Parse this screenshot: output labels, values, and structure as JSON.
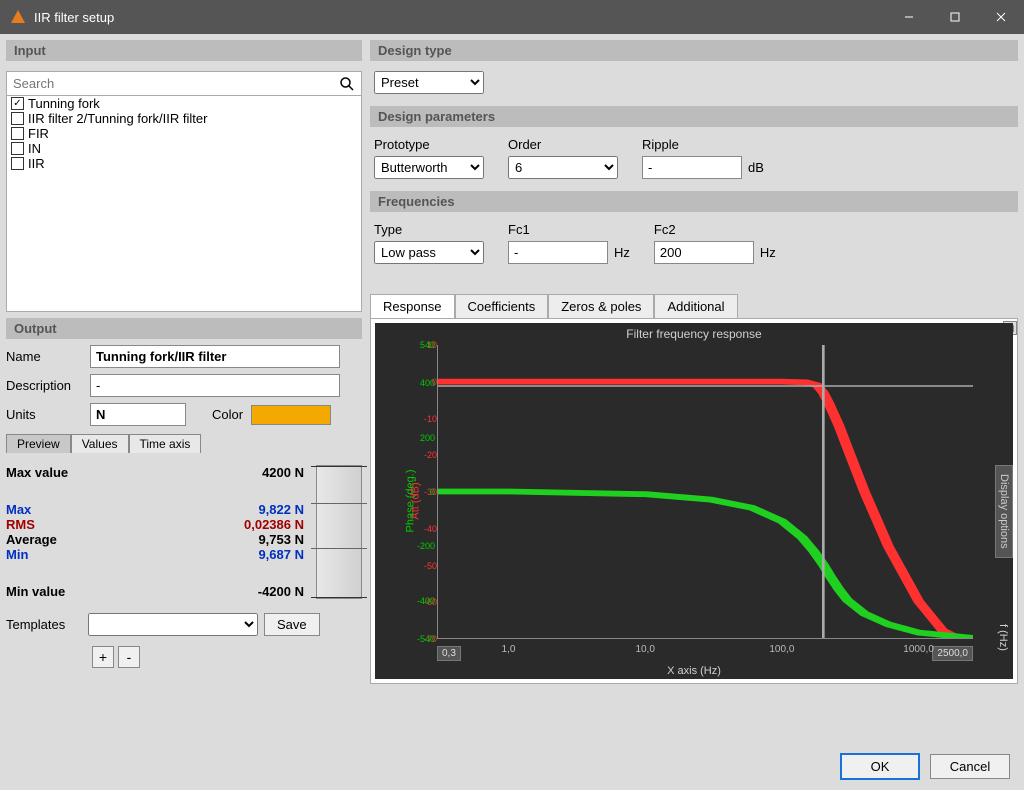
{
  "window": {
    "title": "IIR filter setup"
  },
  "input": {
    "header": "Input",
    "search_placeholder": "Search",
    "items": [
      {
        "label": "Tunning fork",
        "checked": true
      },
      {
        "label": "IIR filter 2/Tunning fork/IIR filter",
        "checked": false
      },
      {
        "label": "FIR",
        "checked": false
      },
      {
        "label": "IN",
        "checked": false
      },
      {
        "label": "IIR",
        "checked": false
      }
    ]
  },
  "output": {
    "header": "Output",
    "name_label": "Name",
    "name_value": "Tunning fork/IIR filter",
    "desc_label": "Description",
    "desc_value": "-",
    "units_label": "Units",
    "units_value": "N",
    "color_label": "Color",
    "color_value": "#f4a900",
    "tabs": {
      "preview": "Preview",
      "values": "Values",
      "time": "Time axis"
    },
    "stats": {
      "maxvalue_label": "Max value",
      "maxvalue": "4200 N",
      "max_label": "Max",
      "max": "9,822 N",
      "rms_label": "RMS",
      "rms": "0,02386 N",
      "avg_label": "Average",
      "avg": "9,753 N",
      "min_label": "Min",
      "min": "9,687 N",
      "minvalue_label": "Min value",
      "minvalue": "-4200 N"
    },
    "templates_label": "Templates",
    "save_label": "Save",
    "plus": "+",
    "minus": "-"
  },
  "design": {
    "design_type_header": "Design type",
    "preset": "Preset",
    "params_header": "Design parameters",
    "prototype_label": "Prototype",
    "prototype": "Butterworth",
    "order_label": "Order",
    "order": "6",
    "ripple_label": "Ripple",
    "ripple": "-",
    "ripple_unit": "dB",
    "freq_header": "Frequencies",
    "type_label": "Type",
    "type": "Low pass",
    "fc1_label": "Fc1",
    "fc1": "-",
    "fc1_unit": "Hz",
    "fc2_label": "Fc2",
    "fc2": "200",
    "fc2_unit": "Hz"
  },
  "graph": {
    "tabs": [
      "Response",
      "Coefficients",
      "Zeros & poles",
      "Additional"
    ],
    "active_tab": "Response",
    "title": "Filter frequency response",
    "xlabel": "X axis (Hz)",
    "xrlabel": "f (Hz)",
    "ylabel_phase": "Phase (deg.)",
    "ylabel_att": "Att (dB)",
    "display_options": "Display options",
    "xmin": "0,3",
    "xmax": "2500,0"
  },
  "footer": {
    "ok": "OK",
    "cancel": "Cancel"
  },
  "chart_data": {
    "type": "line",
    "title": "Filter frequency response",
    "xlabel": "X axis (Hz)",
    "xscale": "log",
    "xlim": [
      0.3,
      2500
    ],
    "xticks": [
      0.3,
      1.0,
      10.0,
      100.0,
      1000.0,
      2500.0
    ],
    "series": [
      {
        "name": "Att (dB)",
        "color": "#ff3030",
        "ylabel": "Att (dB)",
        "ylim": [
          -70,
          10
        ],
        "x": [
          0.3,
          1,
          10,
          50,
          100,
          150,
          180,
          200,
          220,
          260,
          300,
          400,
          600,
          1000,
          1500,
          2500
        ],
        "values": [
          0,
          0,
          0,
          0,
          0,
          -0.2,
          -1,
          -3,
          -6,
          -12,
          -18,
          -30,
          -45,
          -60,
          -68,
          -72
        ]
      },
      {
        "name": "Phase (deg.)",
        "color": "#20d020",
        "ylabel": "Phase (deg.)",
        "ylim": [
          -540,
          540
        ],
        "x": [
          0.3,
          1,
          10,
          30,
          60,
          100,
          140,
          170,
          200,
          230,
          260,
          300,
          400,
          600,
          1000,
          2500
        ],
        "values": [
          0,
          0,
          -10,
          -30,
          -60,
          -110,
          -170,
          -220,
          -270,
          -320,
          -360,
          -400,
          -450,
          -490,
          -520,
          -540
        ]
      }
    ]
  }
}
